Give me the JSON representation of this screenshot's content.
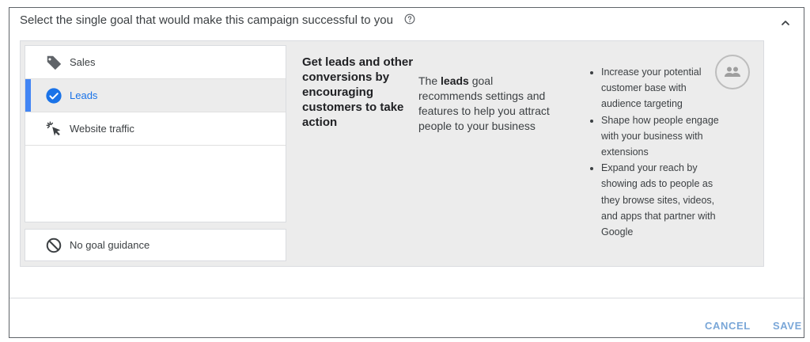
{
  "header": {
    "title": "Select the single goal that would make this campaign successful to you",
    "help_icon": "help-circle-icon",
    "collapse_icon": "chevron-up-icon"
  },
  "goals": [
    {
      "label": "Sales",
      "icon": "tag-icon",
      "selected": false
    },
    {
      "label": "Leads",
      "icon": "check-circle-icon",
      "selected": true
    },
    {
      "label": "Website traffic",
      "icon": "cursor-click-icon",
      "selected": false
    }
  ],
  "no_goal": {
    "label": "No goal guidance",
    "icon": "block-icon"
  },
  "detail": {
    "title": "Get leads and other conversions by encouraging customers to take action",
    "desc_prefix": "The ",
    "desc_bold": "leads",
    "desc_suffix": " goal recommends settings and features to help you attract people to your business",
    "benefits": [
      "Increase your potential customer base with audience targeting",
      "Shape how people engage with your business with extensions",
      "Expand your reach by showing ads to people as they browse sites, videos, and apps that partner with Google"
    ],
    "people_icon": "people-icon"
  },
  "footer": {
    "cancel_label": "CANCEL",
    "save_label": "SAVE"
  },
  "colors": {
    "accent": "#4285f4",
    "selected_text": "#1a73e8",
    "button_text": "#7aa7d8",
    "panel_bg": "#ececec"
  }
}
